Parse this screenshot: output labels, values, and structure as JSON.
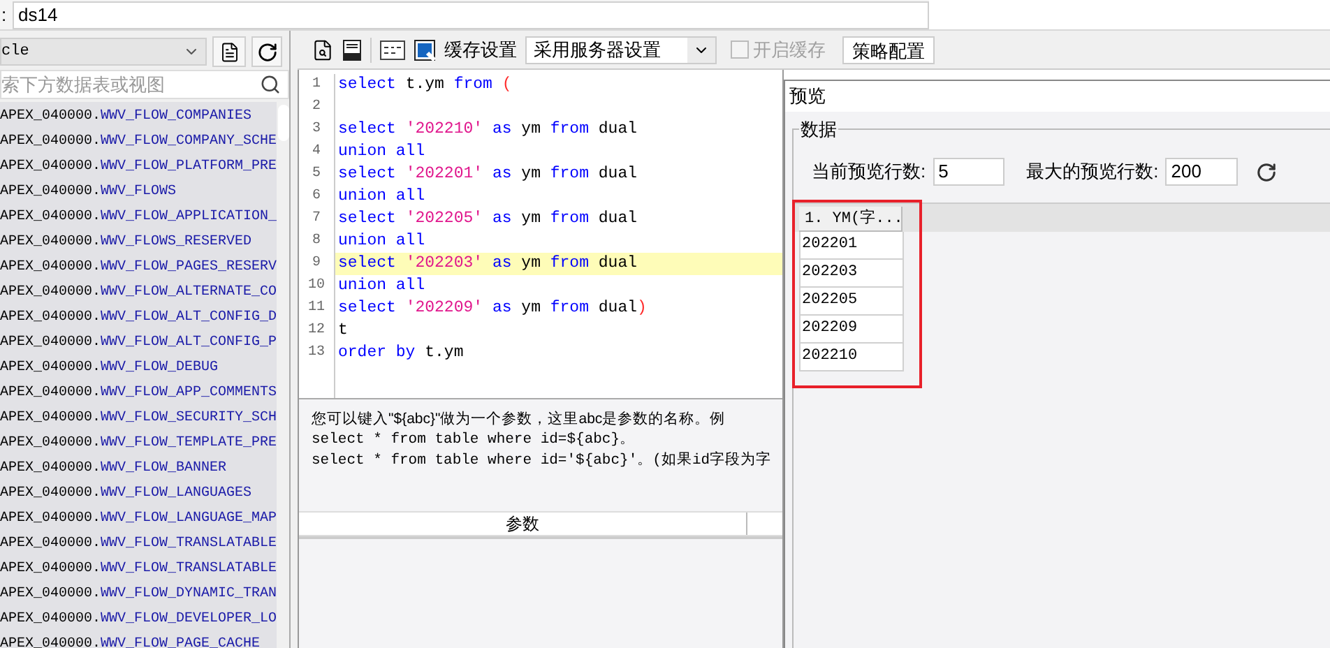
{
  "name_field": {
    "label": ":",
    "value": "ds14"
  },
  "left_panel": {
    "database": "cle",
    "search": {
      "placeholder": "索下方数据表或视图"
    },
    "tables": [
      {
        "schema": "APEX_040000.",
        "table": "WWV_FLOW_COMPANIES"
      },
      {
        "schema": "APEX_040000.",
        "table": "WWV_FLOW_COMPANY_SCHE"
      },
      {
        "schema": "APEX_040000.",
        "table": "WWV_FLOW_PLATFORM_PRE"
      },
      {
        "schema": "APEX_040000.",
        "table": "WWV_FLOWS"
      },
      {
        "schema": "APEX_040000.",
        "table": "WWV_FLOW_APPLICATION_"
      },
      {
        "schema": "APEX_040000.",
        "table": "WWV_FLOWS_RESERVED"
      },
      {
        "schema": "APEX_040000.",
        "table": "WWV_FLOW_PAGES_RESERV"
      },
      {
        "schema": "APEX_040000.",
        "table": "WWV_FLOW_ALTERNATE_CO"
      },
      {
        "schema": "APEX_040000.",
        "table": "WWV_FLOW_ALT_CONFIG_D"
      },
      {
        "schema": "APEX_040000.",
        "table": "WWV_FLOW_ALT_CONFIG_P"
      },
      {
        "schema": "APEX_040000.",
        "table": "WWV_FLOW_DEBUG"
      },
      {
        "schema": "APEX_040000.",
        "table": "WWV_FLOW_APP_COMMENTS"
      },
      {
        "schema": "APEX_040000.",
        "table": "WWV_FLOW_SECURITY_SCH"
      },
      {
        "schema": "APEX_040000.",
        "table": "WWV_FLOW_TEMPLATE_PRE"
      },
      {
        "schema": "APEX_040000.",
        "table": "WWV_FLOW_BANNER"
      },
      {
        "schema": "APEX_040000.",
        "table": "WWV_FLOW_LANGUAGES"
      },
      {
        "schema": "APEX_040000.",
        "table": "WWV_FLOW_LANGUAGE_MAP"
      },
      {
        "schema": "APEX_040000.",
        "table": "WWV_FLOW_TRANSLATABLE"
      },
      {
        "schema": "APEX_040000.",
        "table": "WWV_FLOW_TRANSLATABLE"
      },
      {
        "schema": "APEX_040000.",
        "table": "WWV_FLOW_DYNAMIC_TRAN"
      },
      {
        "schema": "APEX_040000.",
        "table": "WWV_FLOW_DEVELOPER_LO"
      },
      {
        "schema": "APEX_040000.",
        "table": "WWV_FLOW_PAGE_CACHE"
      }
    ]
  },
  "toolbar": {
    "cache_label": "缓存设置",
    "cache_mode": "采用服务器设置",
    "enable_cache": {
      "label": "开启缓存",
      "checked": false,
      "disabled": true
    },
    "strategy_button": "策略配置"
  },
  "editor": {
    "lines": [
      {
        "number": "1",
        "current": false,
        "tokens": [
          {
            "kind": "keyword",
            "text": "select"
          },
          {
            "kind": "plain",
            "text": " t.ym "
          },
          {
            "kind": "keyword",
            "text": "from"
          },
          {
            "kind": "paren",
            "text": " ("
          }
        ]
      },
      {
        "number": "2",
        "current": false
      },
      {
        "number": "3",
        "current": false,
        "tokens": [
          {
            "kind": "keyword",
            "text": "select"
          },
          {
            "kind": "string",
            "text": " '202210'"
          },
          {
            "kind": "keyword",
            "text": " as"
          },
          {
            "kind": "plain",
            "text": " ym "
          },
          {
            "kind": "keyword",
            "text": "from"
          },
          {
            "kind": "plain",
            "text": " dual"
          }
        ]
      },
      {
        "number": "4",
        "current": false,
        "tokens": [
          {
            "kind": "keyword",
            "text": "union all"
          }
        ]
      },
      {
        "number": "5",
        "current": false,
        "tokens": [
          {
            "kind": "keyword",
            "text": "select"
          },
          {
            "kind": "string",
            "text": " '202201'"
          },
          {
            "kind": "keyword",
            "text": " as"
          },
          {
            "kind": "plain",
            "text": " ym "
          },
          {
            "kind": "keyword",
            "text": "from"
          },
          {
            "kind": "plain",
            "text": " dual"
          }
        ]
      },
      {
        "number": "6",
        "current": false,
        "tokens": [
          {
            "kind": "keyword",
            "text": "union all"
          }
        ]
      },
      {
        "number": "7",
        "current": false,
        "tokens": [
          {
            "kind": "keyword",
            "text": "select"
          },
          {
            "kind": "string",
            "text": " '202205'"
          },
          {
            "kind": "keyword",
            "text": " as"
          },
          {
            "kind": "plain",
            "text": " ym "
          },
          {
            "kind": "keyword",
            "text": "from"
          },
          {
            "kind": "plain",
            "text": " dual"
          }
        ]
      },
      {
        "number": "8",
        "current": false,
        "tokens": [
          {
            "kind": "keyword",
            "text": "union all"
          }
        ]
      },
      {
        "number": "9",
        "current": true,
        "tokens": [
          {
            "kind": "keyword",
            "text": "select"
          },
          {
            "kind": "string",
            "text": " '202203'"
          },
          {
            "kind": "keyword",
            "text": " as"
          },
          {
            "kind": "plain",
            "text": " ym "
          },
          {
            "kind": "keyword",
            "text": "from"
          },
          {
            "kind": "plain",
            "text": " dual"
          }
        ]
      },
      {
        "number": "10",
        "current": false,
        "tokens": [
          {
            "kind": "keyword",
            "text": "union all"
          }
        ]
      },
      {
        "number": "11",
        "current": false,
        "tokens": [
          {
            "kind": "keyword",
            "text": "select"
          },
          {
            "kind": "string",
            "text": " '202209'"
          },
          {
            "kind": "keyword",
            "text": " as"
          },
          {
            "kind": "plain",
            "text": " ym "
          },
          {
            "kind": "keyword",
            "text": "from"
          },
          {
            "kind": "plain",
            "text": " dual"
          },
          {
            "kind": "paren",
            "text": ")"
          }
        ]
      },
      {
        "number": "12",
        "current": false,
        "tokens": [
          {
            "kind": "plain",
            "text": "t"
          }
        ]
      },
      {
        "number": "13",
        "current": false,
        "tokens": [
          {
            "kind": "keyword",
            "text": "order by"
          },
          {
            "kind": "plain",
            "text": " t.ym"
          }
        ]
      }
    ]
  },
  "hint": [
    "您可以键入\"${abc}\"做为一个参数，这里abc是参数的名称。例",
    "select * from table where id=${abc}。",
    "select * from table where id='${abc}'。(如果id字段为字"
  ],
  "parameters": {
    "column": "参数"
  },
  "preview": {
    "title": "预览",
    "group": "数据",
    "current_rows": {
      "label": "当前预览行数:",
      "value": "5"
    },
    "max_rows": {
      "label": "最大的预览行数:",
      "value": "200"
    },
    "table": {
      "column": "1. YM(字...",
      "rows": [
        "202201",
        "202203",
        "202205",
        "202209",
        "202210"
      ]
    }
  }
}
